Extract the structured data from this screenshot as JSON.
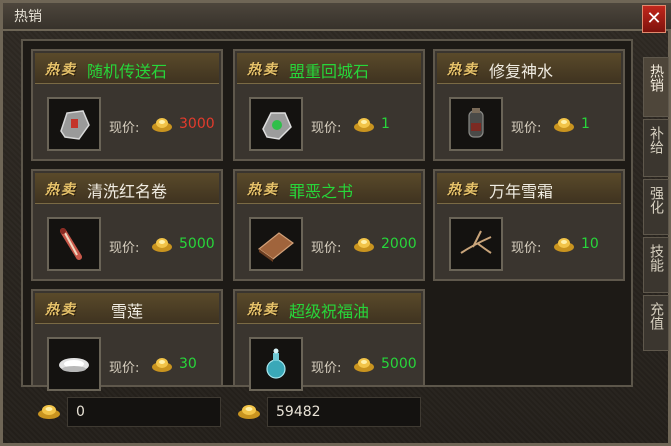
{
  "window": {
    "title": "热销",
    "close_label": "✕"
  },
  "hot_label": "热卖",
  "price_prefix": "现价:",
  "items": [
    {
      "name": "随机传送石",
      "name_color": "#27d63a",
      "price": "3000",
      "price_color": "#e33b2c",
      "icon": "teleport-stone-icon"
    },
    {
      "name": "盟重回城石",
      "name_color": "#27d63a",
      "price": "1",
      "price_color": "#27d63a",
      "icon": "return-stone-icon"
    },
    {
      "name": "修复神水",
      "name_color": "#f0ece2",
      "price": "1",
      "price_color": "#27d63a",
      "icon": "repair-potion-icon"
    },
    {
      "name": "清洗红名卷",
      "name_color": "#f0ece2",
      "price": "5000",
      "price_color": "#27d63a",
      "icon": "scroll-icon"
    },
    {
      "name": "罪恶之书",
      "name_color": "#27d63a",
      "price": "2000",
      "price_color": "#27d63a",
      "icon": "book-icon"
    },
    {
      "name": "万年雪霜",
      "name_color": "#f0ece2",
      "price": "10",
      "price_color": "#27d63a",
      "icon": "root-icon"
    },
    {
      "name": "雪莲",
      "name_color": "#f0ece2",
      "price": "30",
      "price_color": "#27d63a",
      "icon": "snow-lotus-icon"
    },
    {
      "name": "超级祝福油",
      "name_color": "#27d63a",
      "price": "5000",
      "price_color": "#27d63a",
      "icon": "blessing-oil-icon"
    }
  ],
  "side_tabs": [
    "热销",
    "补给",
    "强化",
    "技能",
    "充值"
  ],
  "currency": {
    "gold_ingot": "0",
    "yuanbao": "59482"
  },
  "colors": {
    "accent_gold": "#e6c26a",
    "green": "#27d63a",
    "red": "#e33b2c"
  }
}
